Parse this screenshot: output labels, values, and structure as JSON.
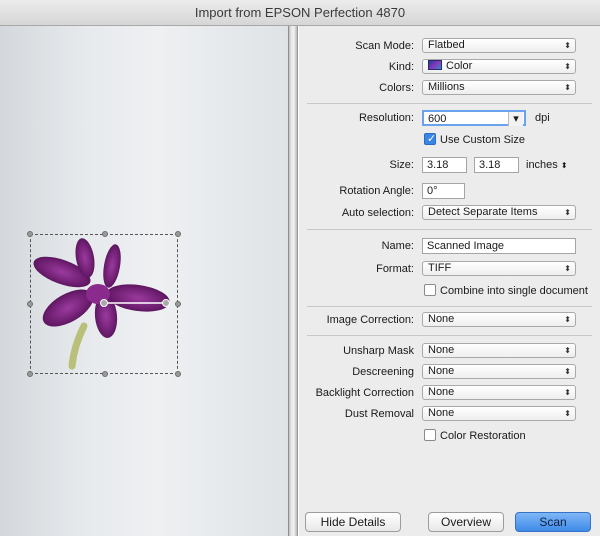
{
  "window": {
    "title": "Import from EPSON Perfection 4870"
  },
  "settings": {
    "scan_mode": {
      "label": "Scan Mode:",
      "value": "Flatbed"
    },
    "kind": {
      "label": "Kind:",
      "value": "Color"
    },
    "colors": {
      "label": "Colors:",
      "value": "Millions"
    },
    "resolution": {
      "label": "Resolution:",
      "value": "600",
      "unit": "dpi"
    },
    "use_custom_size": {
      "label": "Use Custom Size",
      "checked": true
    },
    "size": {
      "label": "Size:",
      "width": "3.18",
      "height": "3.18",
      "unit": "inches"
    },
    "rotation": {
      "label": "Rotation Angle:",
      "value": "0°"
    },
    "auto_selection": {
      "label": "Auto selection:",
      "value": "Detect Separate Items"
    },
    "name": {
      "label": "Name:",
      "value": "Scanned Image"
    },
    "format": {
      "label": "Format:",
      "value": "TIFF"
    },
    "combine": {
      "label": "Combine into single document",
      "checked": false
    },
    "image_correction": {
      "label": "Image Correction:",
      "value": "None"
    },
    "unsharp_mask": {
      "label": "Unsharp Mask",
      "value": "None"
    },
    "descreening": {
      "label": "Descreening",
      "value": "None"
    },
    "backlight_correction": {
      "label": "Backlight Correction",
      "value": "None"
    },
    "dust_removal": {
      "label": "Dust Removal",
      "value": "None"
    },
    "color_restoration": {
      "label": "Color Restoration",
      "checked": false
    }
  },
  "buttons": {
    "hide_details": "Hide Details",
    "overview": "Overview",
    "scan": "Scan"
  },
  "glyphs": {
    "popup_arrows": "⬍",
    "checkmark": "✓",
    "dropdown_arrow": "▾"
  },
  "colors": {
    "scan_button": "#3f8ae8",
    "flower": "#6e1a6e",
    "preview_bg": "#e7eaed"
  }
}
